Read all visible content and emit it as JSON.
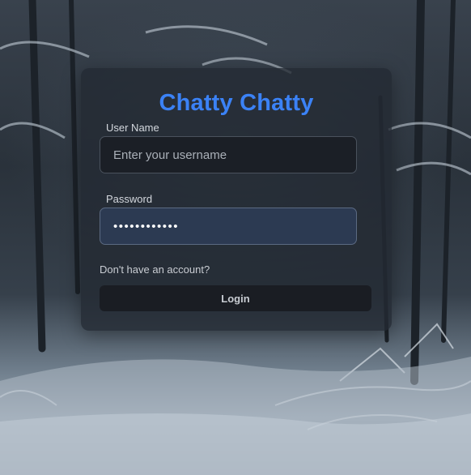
{
  "app": {
    "title": "Chatty Chatty"
  },
  "form": {
    "username": {
      "label": "User Name",
      "placeholder": "Enter your username",
      "value": ""
    },
    "password": {
      "label": "Password",
      "value": "••••••••••••"
    },
    "signup_link": "Don't have an account?",
    "login_label": "Login"
  },
  "colors": {
    "accent": "#3b82f6",
    "card_background": "#222932",
    "password_focus": "#2c3a52"
  },
  "background": {
    "scene": "snowy-forest-image"
  }
}
